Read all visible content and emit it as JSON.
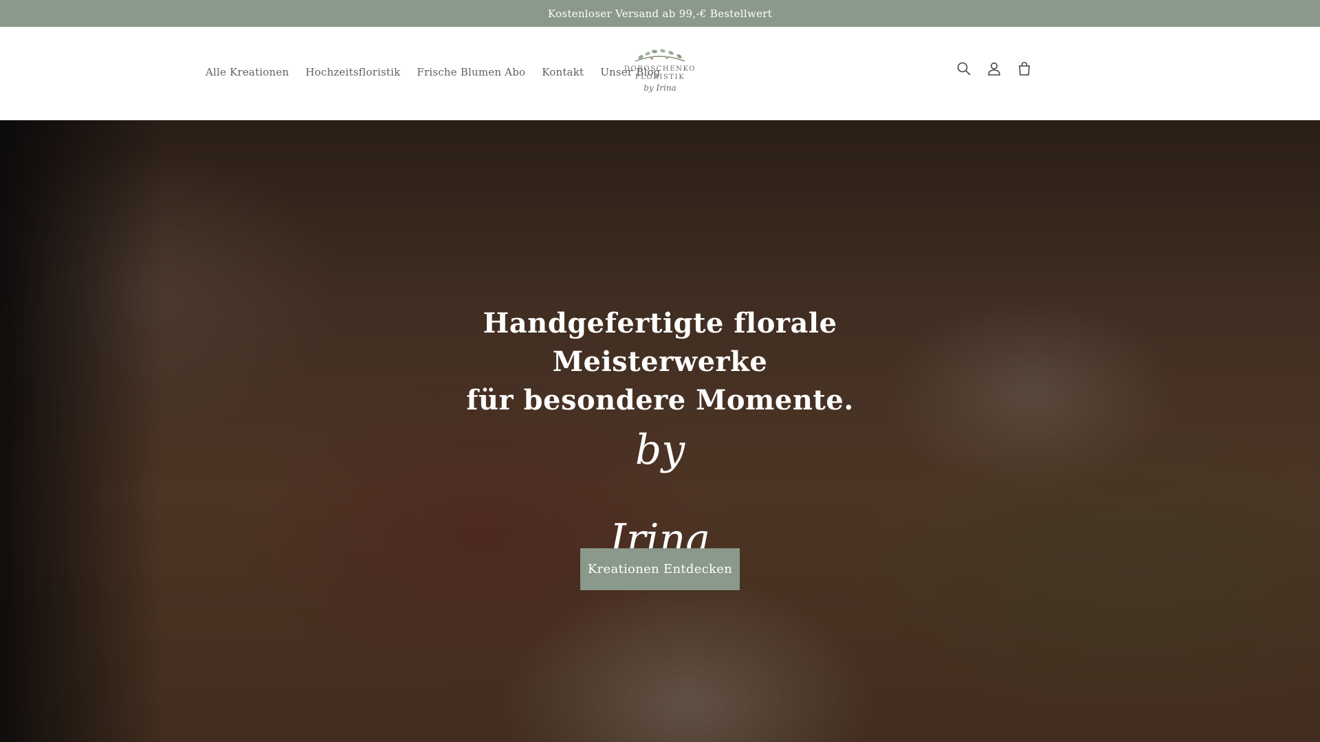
{
  "announcement": {
    "text": "Kostenloser Versand ab 99,-€ Bestellwert"
  },
  "header": {
    "nav": [
      {
        "label": "Alle Kreationen"
      },
      {
        "label": "Hochzeitsfloristik"
      },
      {
        "label": "Frische Blumen Abo"
      },
      {
        "label": "Kontakt"
      },
      {
        "label": "Unser Blog"
      }
    ],
    "logo": {
      "line1": "DOROSCHENKO",
      "line2": "FLORISTIK",
      "line3": "by Irina"
    },
    "icons": [
      "search-icon",
      "account-icon",
      "cart-icon"
    ]
  },
  "hero": {
    "title_line1": "Handgefertigte florale Meisterwerke",
    "title_line2": "für besondere Momente.",
    "script": "by Irina",
    "button_label": "Kreationen Entdecken"
  },
  "colors": {
    "accent": "#8a998b",
    "text_gray": "#5f5f5f"
  }
}
